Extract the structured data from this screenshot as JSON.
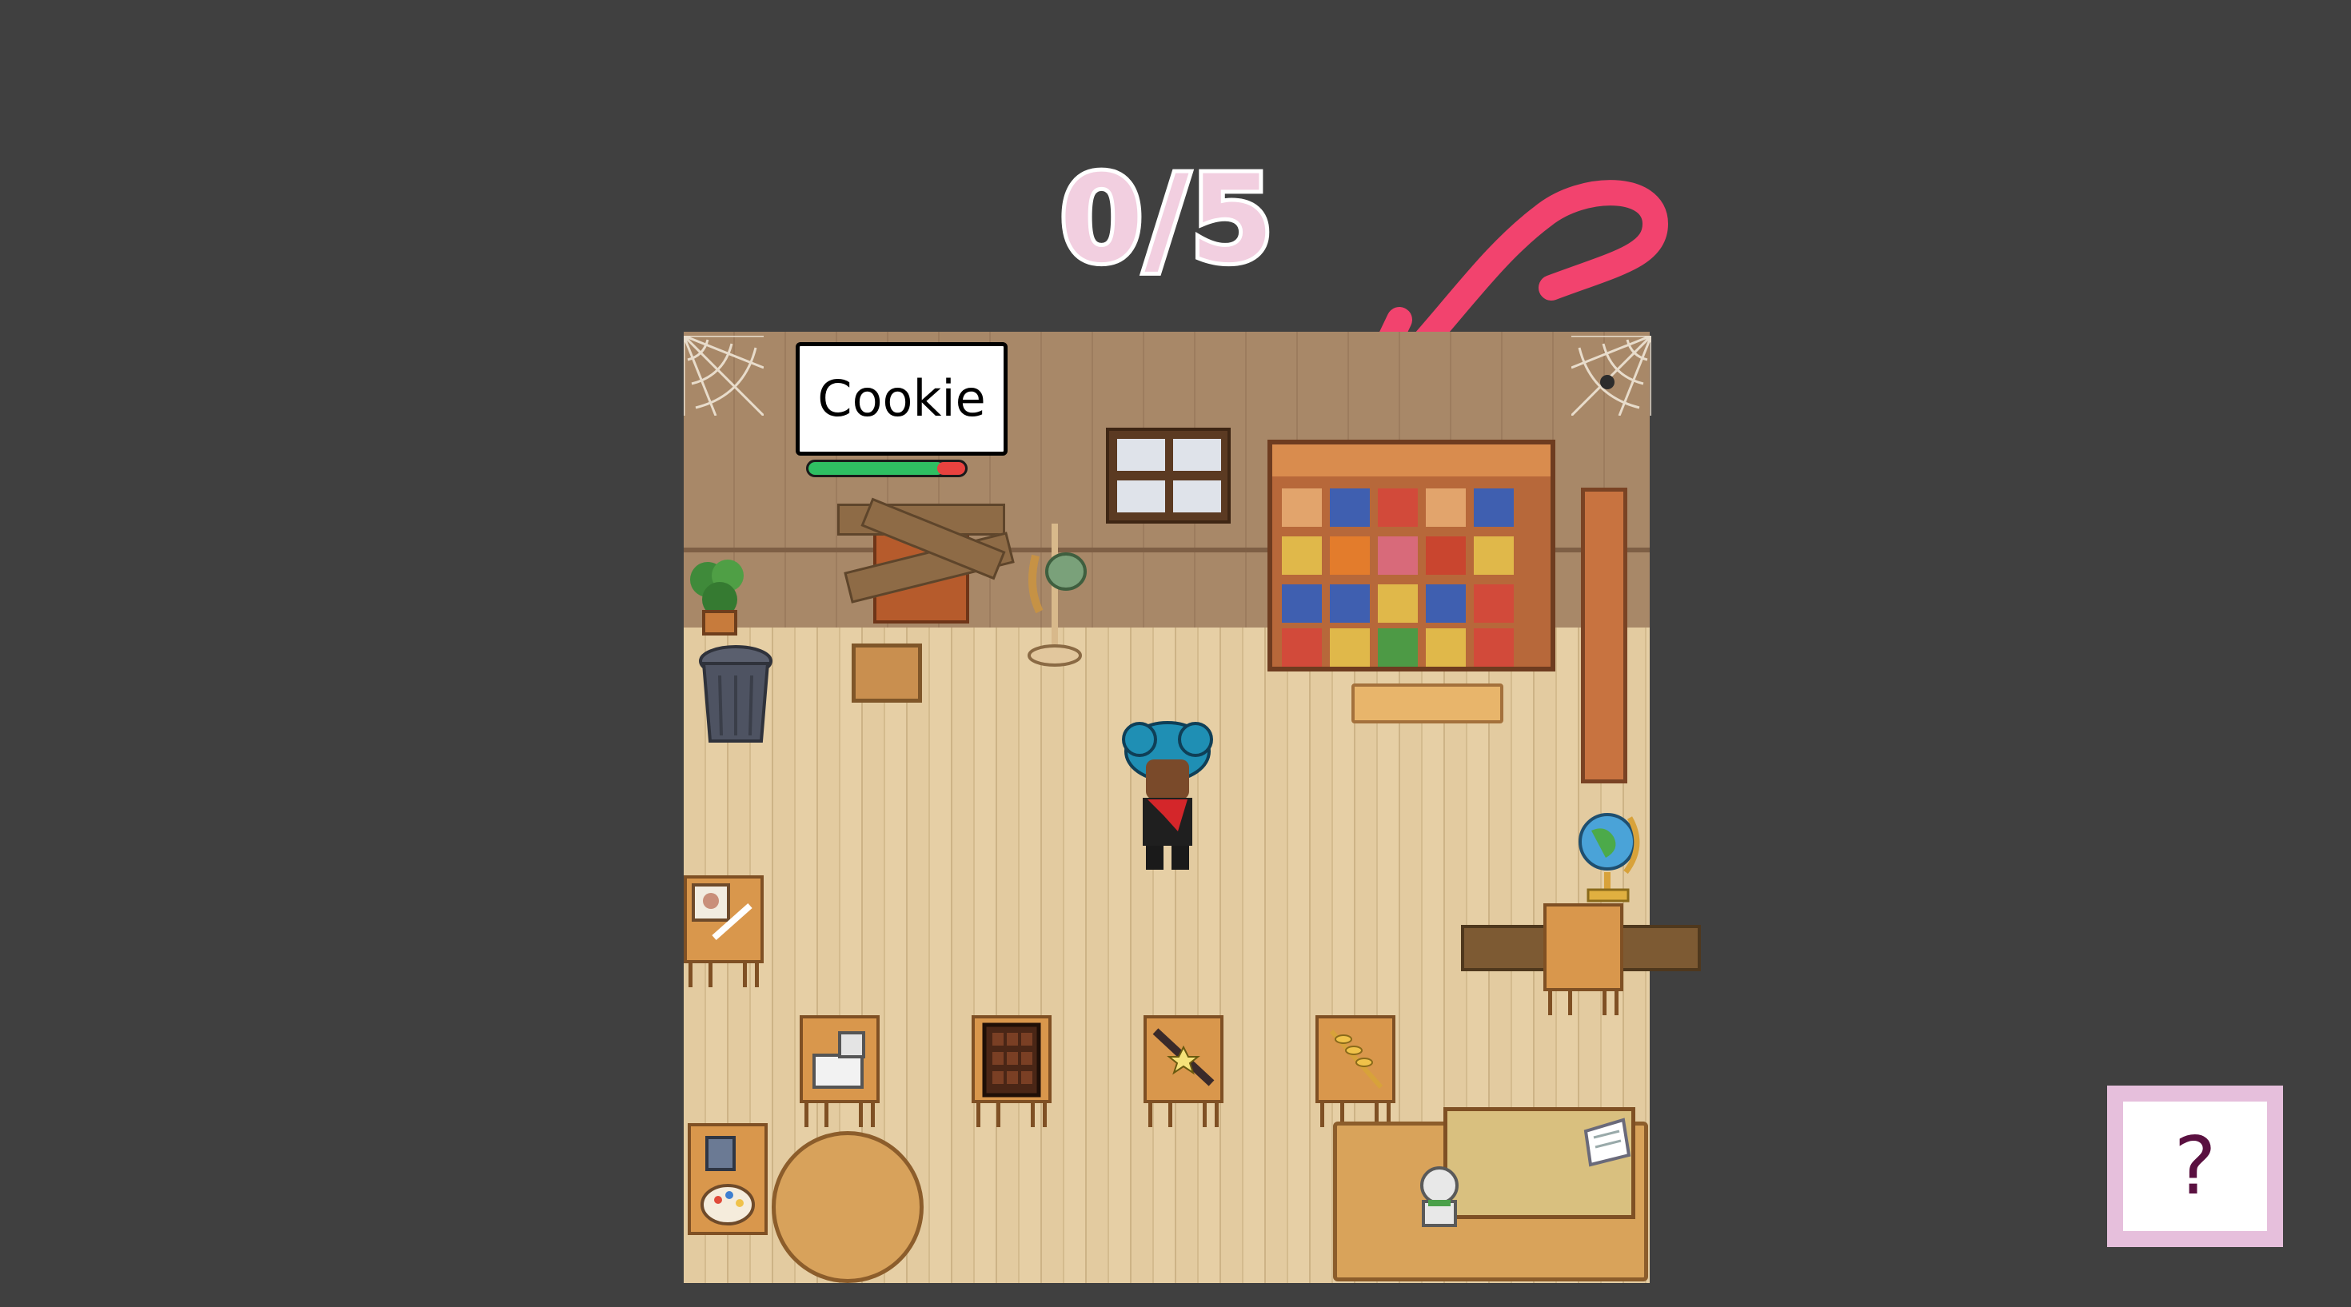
{
  "hud": {
    "score": "0/5",
    "help_label": "?"
  },
  "npc": {
    "name": "Cookie",
    "health_fraction": 0.86
  },
  "colors": {
    "background": "#404040",
    "score_fill": "#f2cfe0",
    "arrow": "#f2436e",
    "help_border": "#e6bfdc",
    "help_text": "#5a1040",
    "health_good": "#2fbf62",
    "health_bad": "#e8423f"
  },
  "icons": {
    "arrow": "curved-arrow-icon",
    "help": "question-mark-icon"
  }
}
